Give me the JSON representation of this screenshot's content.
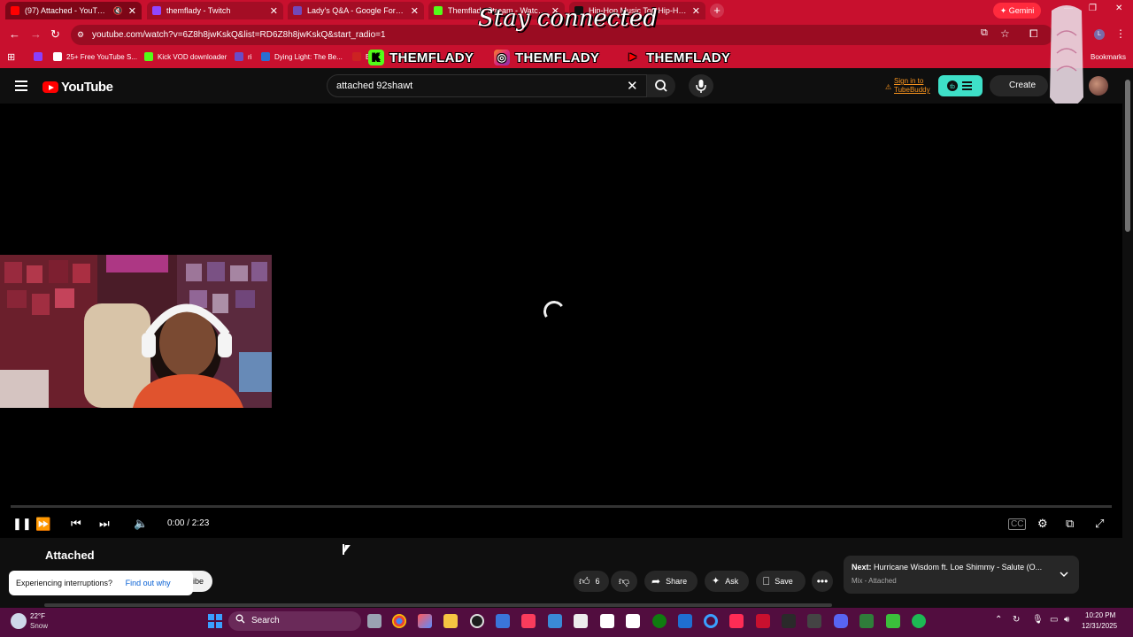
{
  "browser": {
    "tabs": [
      {
        "title": "(97) Attached - YouTube",
        "fav_color": "#ff0000",
        "active": true
      },
      {
        "title": "themflady - Twitch",
        "fav_color": "#9146ff",
        "active": false
      },
      {
        "title": "Lady's Q&A - Google Forms",
        "fav_color": "#7248b9",
        "active": false
      },
      {
        "title": "Themflady Stream - Watch Live",
        "fav_color": "#53fc18",
        "active": false
      },
      {
        "title": "Hip-Hop Music Top Hip-Hop/R...",
        "fav_color": "#111111",
        "active": false
      }
    ],
    "new_tab": "+",
    "gemini_label": "Gemini",
    "url": "youtube.com/watch?v=6Z8h8jwKskQ&list=RD6Z8h8jwKskQ&start_radio=1",
    "bookmarks": [
      {
        "label": "25+ Free YouTube S...",
        "color": "#ffffff"
      },
      {
        "label": "Kick VOD downloader",
        "color": "#53fc18"
      },
      {
        "label": "ri",
        "color": "#6a4cc7"
      },
      {
        "label": "Dying Light: The Be...",
        "color": "#2a6fd1"
      },
      {
        "label": "En",
        "color": "#cc2222"
      }
    ],
    "all_bookmarks": "Bookmarks"
  },
  "stream_overlay": {
    "title": "Stay connected",
    "handles": [
      {
        "platform": "kick-icon",
        "icon_char": "K",
        "handle": "THEMFLADY",
        "color": "#53fc18"
      },
      {
        "platform": "instagram-icon",
        "icon_char": "◎",
        "handle": "THEMFLADY",
        "color": "#d6249f"
      },
      {
        "platform": "youtube-icon",
        "icon_char": "▶",
        "handle": "THEMFLADY",
        "color": "#ff0000"
      }
    ]
  },
  "youtube": {
    "logo_text": "YouTube",
    "search_value": "attached 92shawt",
    "tubebuddy_line1": "Sign in to",
    "tubebuddy_line2": "TubeBuddy",
    "create_label": "Create",
    "player": {
      "time": "0:00 / 2:23",
      "progress": 0.0
    },
    "video_title": "Attached",
    "interrupt_text": "Experiencing interruptions?",
    "interrupt_link": "Find out why",
    "subscribe_fragment": "ibe",
    "like_count": "6",
    "share_label": "Share",
    "ask_label": "Ask",
    "save_label": "Save",
    "next_prefix": "Next:",
    "next_title": "Hurricane Wisdom ft. Loe Shimmy - Salute (O...",
    "next_sub": "Mix - Attached"
  },
  "taskbar": {
    "weather_temp": "22°F",
    "weather_desc": "Snow",
    "search_label": "Search",
    "clock_time": "10:20 PM",
    "clock_date": "12/31/2025"
  }
}
